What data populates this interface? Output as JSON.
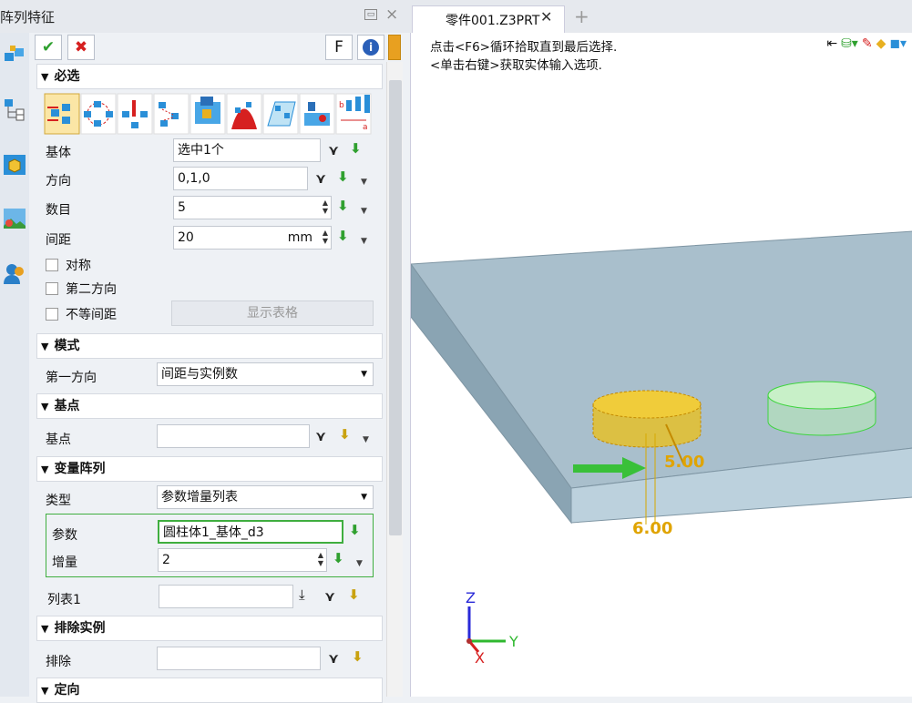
{
  "window": {
    "panel_title": "阵列特征",
    "tab_title": "零件001.Z3PRT",
    "pin_label": "▭",
    "close_label": "×",
    "new_tab_label": "+"
  },
  "toolbar": {
    "ok": "✔",
    "cancel": "✖",
    "f_label": "F",
    "info_label": "i"
  },
  "sections": {
    "required": "必选",
    "mode": "模式",
    "base_point": "基点",
    "variable_pattern": "变量阵列",
    "exclude": "排除实例",
    "orient": "定向"
  },
  "required": {
    "pattern_types_selected": 0,
    "base_label": "基体",
    "base_value": "选中1个",
    "direction_label": "方向",
    "direction_value": "0,1,0",
    "count_label": "数目",
    "count_value": "5",
    "spacing_label": "间距",
    "spacing_value": "20",
    "spacing_unit": "mm",
    "symmetric_label": "对称",
    "second_dir_label": "第二方向",
    "unequal_label": "不等间距",
    "show_table_button": "显示表格"
  },
  "mode": {
    "first_dir_label": "第一方向",
    "first_dir_value": "间距与实例数"
  },
  "base_point": {
    "label": "基点",
    "value": ""
  },
  "variable": {
    "type_label": "类型",
    "type_value": "参数增量列表",
    "param_label": "参数",
    "param_value": "圆柱体1_基体_d3",
    "incr_label": "增量",
    "incr_value": "2",
    "list_label": "列表1",
    "list_value": ""
  },
  "exclude": {
    "label": "排除",
    "value": ""
  },
  "viewport": {
    "prompt_line1": "点击<F6>循环拾取直到最后选择.",
    "prompt_line2": "<单击右键>获取实体输入选项.",
    "dim1": "5.00",
    "dim2": "6.00",
    "axis_x": "X",
    "axis_y": "Y",
    "axis_z": "Z"
  },
  "colors": {
    "accent": "#2fa02f",
    "cancel": "#d62020",
    "plate_top": "#a9bfcc",
    "cylinder": "#e8c020",
    "preview": "#4cd44c"
  }
}
